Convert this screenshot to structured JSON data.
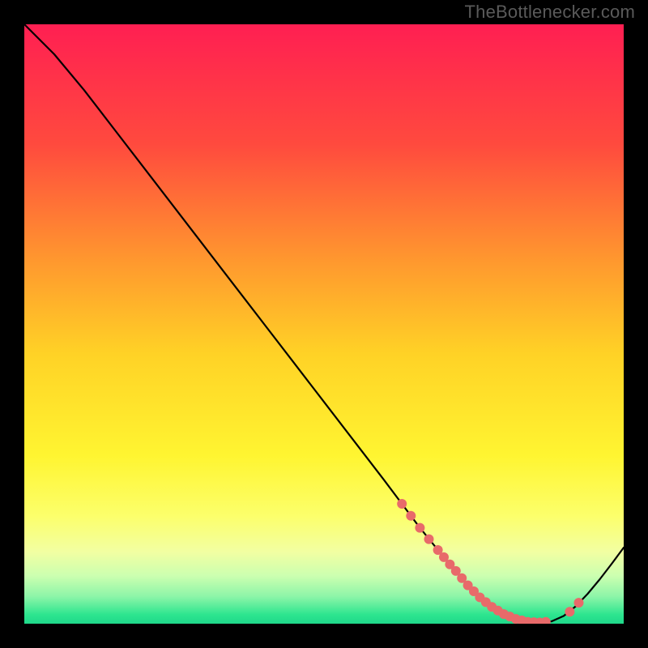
{
  "attribution": "TheBottlenecker.com",
  "chart_data": {
    "type": "line",
    "title": "",
    "xlabel": "",
    "ylabel": "",
    "xlim": [
      0,
      100
    ],
    "ylim": [
      0,
      100
    ],
    "x": [
      0,
      5,
      10,
      15,
      20,
      25,
      30,
      35,
      40,
      45,
      50,
      55,
      60,
      63,
      66,
      69,
      72,
      74,
      76,
      78,
      80,
      82,
      84,
      86,
      88,
      90,
      92,
      94,
      96,
      98,
      100
    ],
    "y": [
      100,
      95,
      89,
      82.5,
      76,
      69.5,
      63,
      56.5,
      50,
      43.5,
      37,
      30.5,
      24,
      20,
      16,
      12.3,
      8.8,
      6.4,
      4.4,
      2.8,
      1.6,
      0.8,
      0.3,
      0.2,
      0.4,
      1.3,
      2.9,
      5.0,
      7.4,
      10.0,
      12.7
    ],
    "mark_points": {
      "x": [
        63,
        64.5,
        66,
        67.5,
        69,
        70,
        71,
        72,
        73,
        74,
        75,
        76,
        77,
        78,
        79,
        80,
        81,
        82,
        83,
        84,
        85,
        86,
        87,
        91,
        92.5
      ],
      "y": [
        20,
        18,
        16,
        14.1,
        12.3,
        11.1,
        9.9,
        8.8,
        7.6,
        6.4,
        5.4,
        4.4,
        3.6,
        2.8,
        2.2,
        1.6,
        1.2,
        0.8,
        0.55,
        0.3,
        0.25,
        0.2,
        0.3,
        2.0,
        3.5
      ]
    },
    "background": {
      "type": "vertical_gradient",
      "stops": [
        {
          "offset": 0.0,
          "color": "#ff1f52"
        },
        {
          "offset": 0.2,
          "color": "#ff4a3e"
        },
        {
          "offset": 0.4,
          "color": "#ff9a2e"
        },
        {
          "offset": 0.55,
          "color": "#ffd226"
        },
        {
          "offset": 0.72,
          "color": "#fff531"
        },
        {
          "offset": 0.82,
          "color": "#fcff6b"
        },
        {
          "offset": 0.88,
          "color": "#f2ffa2"
        },
        {
          "offset": 0.92,
          "color": "#ccffb0"
        },
        {
          "offset": 0.955,
          "color": "#8cf5a8"
        },
        {
          "offset": 0.985,
          "color": "#2de58f"
        },
        {
          "offset": 1.0,
          "color": "#1fd88a"
        }
      ]
    }
  }
}
